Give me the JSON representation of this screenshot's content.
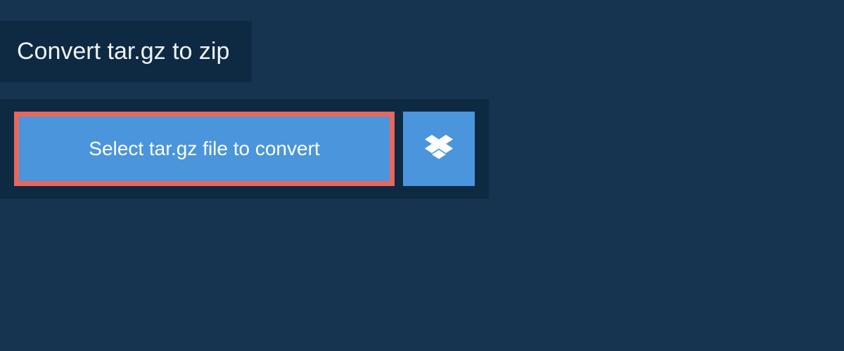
{
  "header": {
    "title": "Convert tar.gz to zip"
  },
  "main": {
    "select_button_label": "Select tar.gz file to convert"
  },
  "colors": {
    "background_outer": "#163450",
    "background_panel": "#0e2a43",
    "button_primary": "#4a95db",
    "button_highlight_border": "#e8675c",
    "text_light": "#f0f2f5"
  }
}
